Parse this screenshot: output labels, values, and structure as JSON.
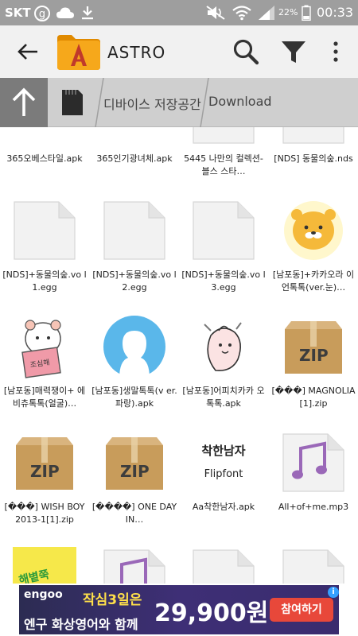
{
  "status_bar": {
    "carrier": "SKT",
    "battery": "22%",
    "time": "00:33",
    "icons": [
      "g-circle-icon",
      "cloud-icon",
      "download-icon",
      "mute-icon",
      "wifi-icon",
      "signal-icon",
      "battery-icon"
    ]
  },
  "app_bar": {
    "title": "ASTRO",
    "icons": [
      "back-arrow-icon",
      "astro-folder-logo",
      "search-icon",
      "filter-icon",
      "more-vert-icon"
    ],
    "colors": {
      "bar": "#f1f1f1",
      "logo_orange": "#f4a300"
    }
  },
  "breadcrumb": {
    "segments": [
      "디바이스 저장공간",
      "Download"
    ],
    "icons": [
      "up-arrow-icon",
      "sd-card-icon"
    ],
    "colors": {
      "bar": "#cfcfcf",
      "up_button": "#7b7b7b"
    }
  },
  "files": [
    {
      "name": "365오베스타일.apk",
      "type": "flipfont-red"
    },
    {
      "name": "365인기광녀체.apk",
      "type": "flipfont-pink"
    },
    {
      "name": "5445 나만의 컬렉션-블스 스타…",
      "type": "blank"
    },
    {
      "name": "[NDS] 동물의숲.nds",
      "type": "blank"
    },
    {
      "name": "[NDS]+동물의숲.vo l1.egg",
      "type": "blank"
    },
    {
      "name": "[NDS]+동물의숲.vo l2.egg",
      "type": "blank"
    },
    {
      "name": "[NDS]+동물의숲.vo l3.egg",
      "type": "blank"
    },
    {
      "name": "[남포동]+카카오라 이언톡톡(ver.눈)…",
      "type": "sticker-lion"
    },
    {
      "name": "[남포동]매력쟁이+ 에비츄톡톡(얼굴)…",
      "type": "sticker-hamster"
    },
    {
      "name": "[남포동]생말톡톡(v er.파랑).apk",
      "type": "sticker-silhouette"
    },
    {
      "name": "[남포동]어피치카카 오톡톡.apk",
      "type": "sticker-apeach"
    },
    {
      "name": "[���] MAGNOLIA[1].zip",
      "type": "zip"
    },
    {
      "name": "[���] WISH BOY 2013-1[1].zip",
      "type": "zip"
    },
    {
      "name": "[����] ONE DAY IN…",
      "type": "zip"
    },
    {
      "name": "Aa착한남자.apk",
      "type": "flipfont-text"
    },
    {
      "name": "All+of+me.mp3",
      "type": "music"
    },
    {
      "name": "",
      "type": "yellow-partial"
    },
    {
      "name": "",
      "type": "music-partial"
    },
    {
      "name": "",
      "type": "blank"
    },
    {
      "name": "",
      "type": "blank"
    }
  ],
  "thumb_text": {
    "flipfont": "Flipfont",
    "zip": "ZIP",
    "sticker_label": "조심해",
    "flipfont_title": "착한남자",
    "flipfont_sub": "Flipfont",
    "partial_yellow": "해볕쭉"
  },
  "ad": {
    "brand": "engoo",
    "headline": "작심3일은",
    "sub": "엔구 화상영어와 함께",
    "price": "29,900원",
    "cta": "참여하기",
    "info": "i",
    "colors": {
      "bg": "#3a2c6e",
      "cta": "#e8483a",
      "headline": "#ffe04a"
    }
  }
}
